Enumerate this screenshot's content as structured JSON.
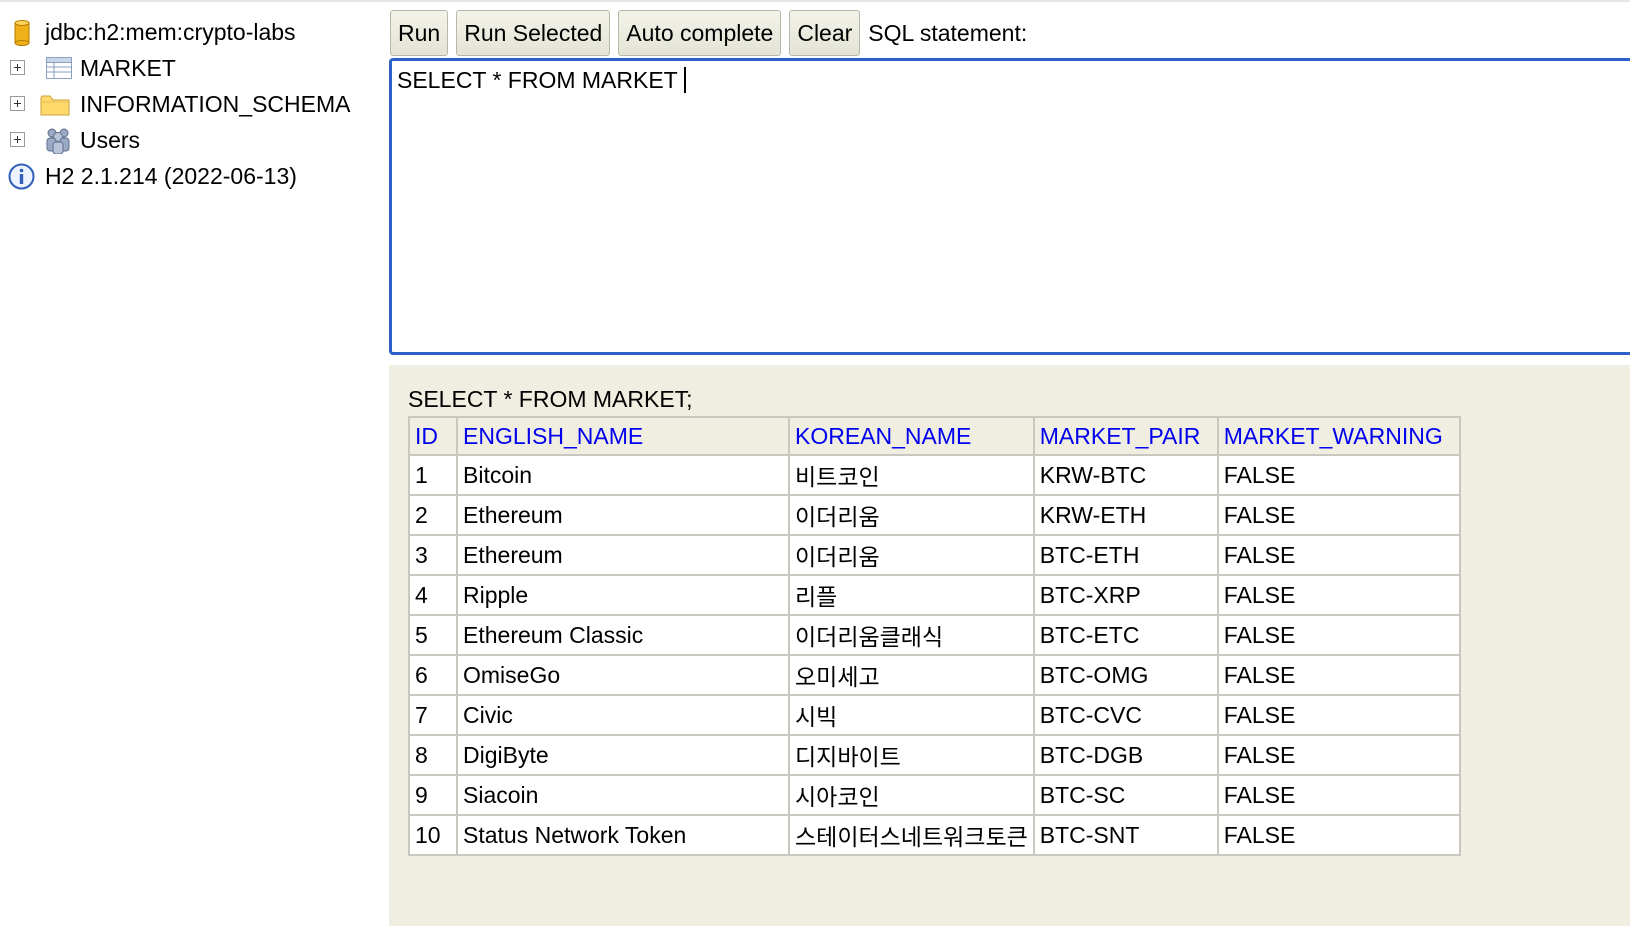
{
  "tree": {
    "connection": {
      "label": "jdbc:h2:mem:crypto-labs",
      "icon": "database-icon"
    },
    "items": [
      {
        "label": "MARKET",
        "icon": "table-icon"
      },
      {
        "label": "INFORMATION_SCHEMA",
        "icon": "folder-icon"
      },
      {
        "label": "Users",
        "icon": "users-icon"
      }
    ],
    "version": {
      "label": "H2 2.1.214 (2022-06-13)",
      "icon": "info-icon"
    }
  },
  "toolbar": {
    "run_label": "Run",
    "run_selected_label": "Run Selected",
    "auto_complete_label": "Auto complete",
    "clear_label": "Clear",
    "sql_statement_label": "SQL statement:"
  },
  "editor": {
    "text": "SELECT * FROM MARKET"
  },
  "result": {
    "statement": "SELECT * FROM MARKET;",
    "columns": [
      "ID",
      "ENGLISH_NAME",
      "KOREAN_NAME",
      "MARKET_PAIR",
      "MARKET_WARNING"
    ],
    "rows": [
      [
        "1",
        "Bitcoin",
        "비트코인",
        "KRW-BTC",
        "FALSE"
      ],
      [
        "2",
        "Ethereum",
        "이더리움",
        "KRW-ETH",
        "FALSE"
      ],
      [
        "3",
        "Ethereum",
        "이더리움",
        "BTC-ETH",
        "FALSE"
      ],
      [
        "4",
        "Ripple",
        "리플",
        "BTC-XRP",
        "FALSE"
      ],
      [
        "5",
        "Ethereum Classic",
        "이더리움클래식",
        "BTC-ETC",
        "FALSE"
      ],
      [
        "6",
        "OmiseGo",
        "오미세고",
        "BTC-OMG",
        "FALSE"
      ],
      [
        "7",
        "Civic",
        "시빅",
        "BTC-CVC",
        "FALSE"
      ],
      [
        "8",
        "DigiByte",
        "디지바이트",
        "BTC-DGB",
        "FALSE"
      ],
      [
        "9",
        "Siacoin",
        "시아코인",
        "BTC-SC",
        "FALSE"
      ],
      [
        "10",
        "Status Network Token",
        "스테이터스네트워크토큰",
        "BTC-SNT",
        "FALSE"
      ]
    ]
  },
  "colors": {
    "editor_border": "#2c62c8",
    "header_link": "#0000ee",
    "panel_bg": "#f0eee0"
  }
}
